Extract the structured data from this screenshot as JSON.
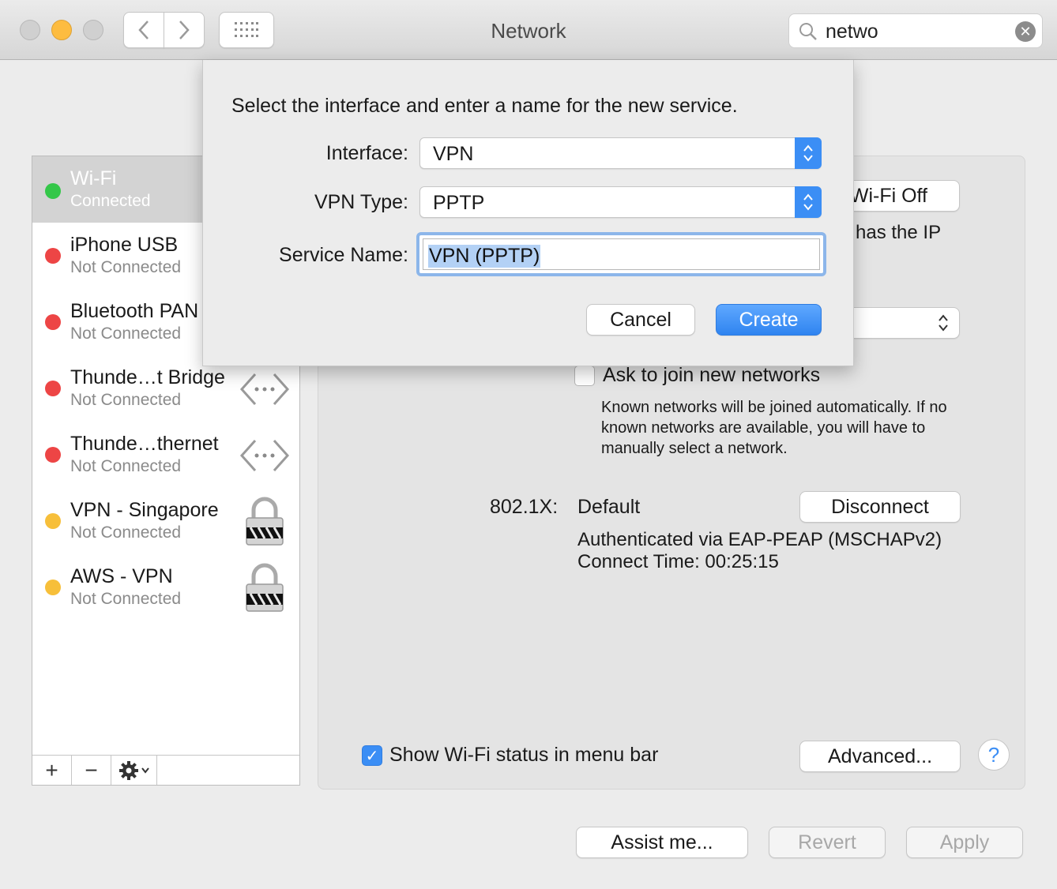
{
  "window": {
    "title": "Network",
    "search": {
      "value": "netwo",
      "placeholder": "Search"
    }
  },
  "sidebar": {
    "services": [
      {
        "name": "Wi-Fi",
        "status": "Connected",
        "status_color": "#34c749",
        "selected": true,
        "icon": ""
      },
      {
        "name": "iPhone USB",
        "status": "Not Connected",
        "status_color": "#ed4545",
        "icon": ""
      },
      {
        "name": "Bluetooth PAN",
        "status": "Not Connected",
        "status_color": "#ed4545",
        "icon": ""
      },
      {
        "name": "Thunde…t Bridge",
        "status": "Not Connected",
        "status_color": "#ed4545",
        "icon": "ethernet-arrows-icon"
      },
      {
        "name": "Thunde…thernet",
        "status": "Not Connected",
        "status_color": "#ed4545",
        "icon": "ethernet-arrows-icon"
      },
      {
        "name": "VPN - Singapore",
        "status": "Not Connected",
        "status_color": "#f7bf3a",
        "icon": "vpn-lock-icon"
      },
      {
        "name": "AWS - VPN",
        "status": "Not Connected",
        "status_color": "#f7bf3a",
        "icon": "vpn-lock-icon"
      }
    ],
    "add_label": "+",
    "remove_label": "−"
  },
  "panel": {
    "wifi_off_button": "Wi-Fi Off",
    "ip_text_fragment": "has the IP",
    "ask_join_label": "Ask to join new networks",
    "ask_join_help": "Known networks will be joined automatically. If no known networks are available, you will have to manually select a network.",
    "dot1x_label": "802.1X:",
    "dot1x_value": "Default",
    "disconnect_button": "Disconnect",
    "auth_text": "Authenticated via EAP-PEAP (MSCHAPv2)",
    "connect_time": "Connect Time: 00:25:15",
    "show_status_label": "Show Wi-Fi status in menu bar",
    "show_status_checked": true,
    "advanced_button": "Advanced...",
    "help_button": "?"
  },
  "footer": {
    "assist_button": "Assist me...",
    "revert_button": "Revert",
    "apply_button": "Apply"
  },
  "sheet": {
    "title": "Select the interface and enter a name for the new service.",
    "interface_label": "Interface:",
    "interface_value": "VPN",
    "vpn_type_label": "VPN Type:",
    "vpn_type_value": "PPTP",
    "service_name_label": "Service Name:",
    "service_name_value": "VPN (PPTP)",
    "cancel_button": "Cancel",
    "create_button": "Create"
  },
  "colors": {
    "accent": "#3b8ef5",
    "connected": "#34c749",
    "disconnected": "#ed4545",
    "vpn": "#f7bf3a"
  }
}
